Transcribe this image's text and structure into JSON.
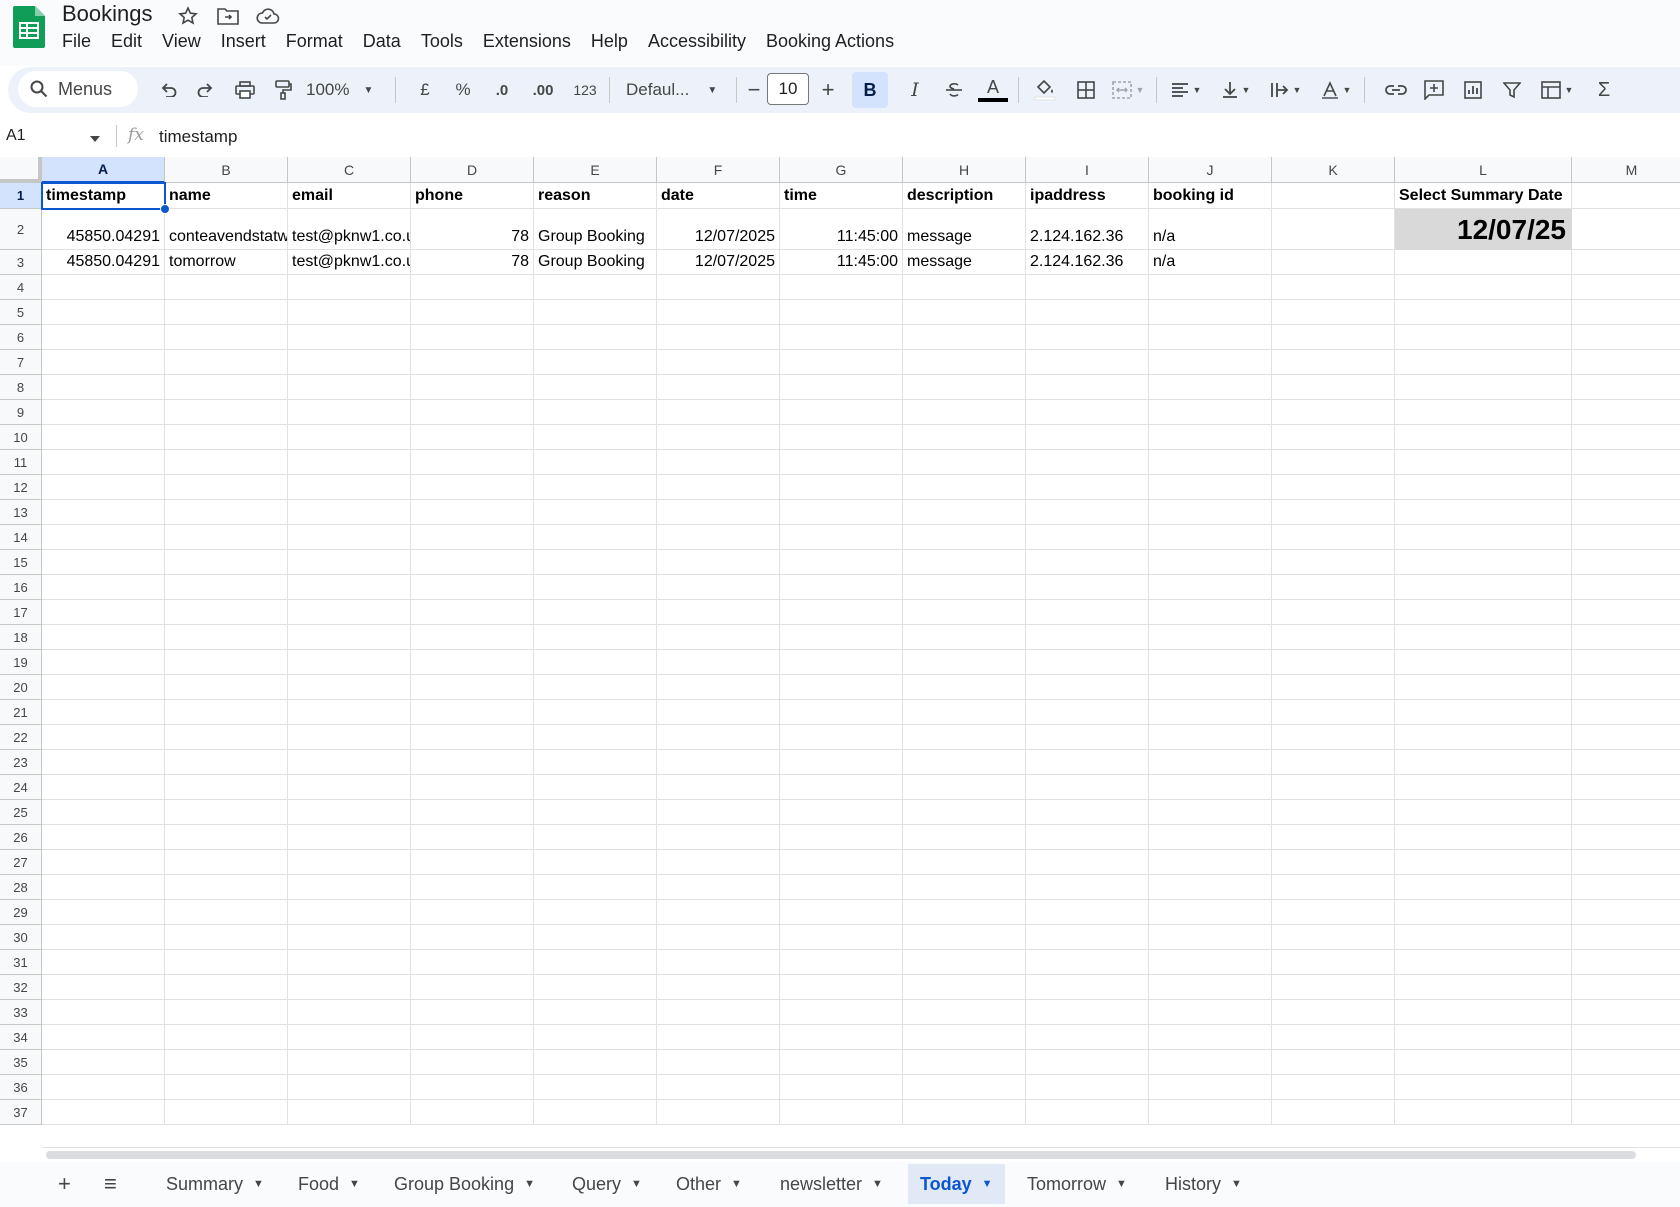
{
  "document": {
    "title": "Bookings"
  },
  "menu": [
    "File",
    "Edit",
    "View",
    "Insert",
    "Format",
    "Data",
    "Tools",
    "Extensions",
    "Help",
    "Accessibility",
    "Booking Actions"
  ],
  "toolbar": {
    "search_label": "Menus",
    "zoom": "100%",
    "currency": "£",
    "percent": "%",
    "dec_decrease": ".0",
    "dec_increase": ".00",
    "number_format": "123",
    "font": "Defaul...",
    "font_size": "10",
    "bold": "B",
    "italic": "I",
    "text_color_letter": "A",
    "minus": "−",
    "plus": "+",
    "sum": "Σ"
  },
  "formula_bar": {
    "cell_ref": "A1",
    "fx": "fx",
    "value": "timestamp"
  },
  "columns": [
    "A",
    "B",
    "C",
    "D",
    "E",
    "F",
    "G",
    "H",
    "I",
    "J",
    "K",
    "L",
    "M"
  ],
  "rows": {
    "header": [
      "timestamp",
      "name",
      "email",
      "phone",
      "reason",
      "date",
      "time",
      "description",
      "ipaddress",
      "booking id",
      "",
      "Select Summary Date"
    ],
    "data": [
      [
        "45850.04291",
        "conteavendstatw",
        "test@pknw1.co.u",
        "78",
        "Group Booking",
        "12/07/2025",
        "11:45:00",
        "message",
        "2.124.162.36",
        "n/a",
        "",
        "12/07/25"
      ],
      [
        "45850.04291",
        "tomorrow",
        "test@pknw1.co.u",
        "78",
        "Group Booking",
        "12/07/2025",
        "11:45:00",
        "message",
        "2.124.162.36",
        "n/a",
        "",
        ""
      ]
    ],
    "row_numbers": [
      "1",
      "2",
      "3",
      "4",
      "5",
      "6",
      "7",
      "8",
      "9",
      "10",
      "11",
      "12",
      "13",
      "14",
      "15",
      "16",
      "17",
      "18",
      "19",
      "20",
      "21",
      "22",
      "23",
      "24",
      "25",
      "26",
      "27",
      "28",
      "29",
      "30",
      "31",
      "32",
      "33",
      "34",
      "35",
      "36",
      "37"
    ]
  },
  "sheets": {
    "add": "+",
    "list": "≡",
    "tabs": [
      "Summary",
      "Food",
      "Group Booking",
      "Query",
      "Other",
      "newsletter",
      "Today",
      "Tomorrow",
      "History"
    ],
    "active": "Today"
  },
  "colors": {
    "accent": "#0b57d0",
    "selected_header": "#d3e3fd",
    "summary_fill": "#d9d9d9",
    "sheets_green": "#0f9d58"
  }
}
